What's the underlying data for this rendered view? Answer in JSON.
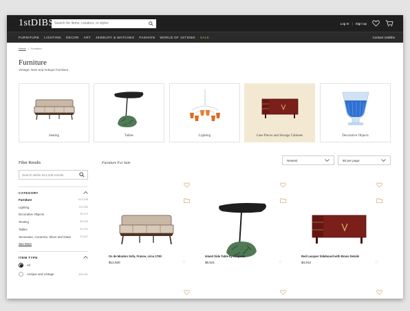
{
  "header": {
    "logo": "1stDIBS",
    "search_placeholder": "Search for items, creators, or styles",
    "login_label": "Log In",
    "separator": "|",
    "signup_label": "Sign Up"
  },
  "nav": {
    "items": [
      "Furniture",
      "Lighting",
      "Decor",
      "Art",
      "Jewelry & Watches",
      "Fashion",
      "World of 1stDibs",
      "Sale"
    ],
    "contact_label": "Contact 1stDibs"
  },
  "breadcrumb": {
    "home": "Home",
    "sep": "/",
    "current": "Furniture"
  },
  "page": {
    "title": "Furniture",
    "subtitle": "Vintage, New and Antique Furniture"
  },
  "categories": [
    {
      "label": "Seating"
    },
    {
      "label": "Tables"
    },
    {
      "label": "Lighting"
    },
    {
      "label": "Case Pieces and Storage Cabinets"
    },
    {
      "label": "Decorative Objects"
    }
  ],
  "filters": {
    "title": "Filter Results",
    "search_placeholder": "Search within 613,348 results",
    "category_heading": "CATEGORY",
    "category_items": [
      {
        "name": "Furniture",
        "count": "613,348"
      },
      {
        "name": "Lighting",
        "count": "110,089"
      },
      {
        "name": "Decorative Objects",
        "count": "96,274"
      },
      {
        "name": "Seating",
        "count": "85,342"
      },
      {
        "name": "Tables",
        "count": "82,101"
      },
      {
        "name": "Serveware, Ceramics, Silver and Glass",
        "count": "53,647"
      }
    ],
    "see_more": "See More",
    "item_type_heading": "ITEM TYPE",
    "item_types": [
      {
        "name": "All",
        "count": ""
      },
      {
        "name": "Antique and Vintage",
        "count": "465,492"
      }
    ]
  },
  "results": {
    "heading": "Furniture For Sale",
    "sort_value": "Newest",
    "per_page_value": "60 per page"
  },
  "products": [
    {
      "title": "Os de Mouton Sofa, France, circa 1790",
      "price": "$12,500"
    },
    {
      "title": "Island Side Table by Krzywda",
      "price": "$6,521"
    },
    {
      "title": "Red Lacquer Sideboard with Brass Details",
      "price": "$4,912"
    }
  ],
  "colors": {
    "header_bg": "#1f1f1f",
    "sale": "#c8a85b",
    "active_card": "#f3e9d3"
  }
}
